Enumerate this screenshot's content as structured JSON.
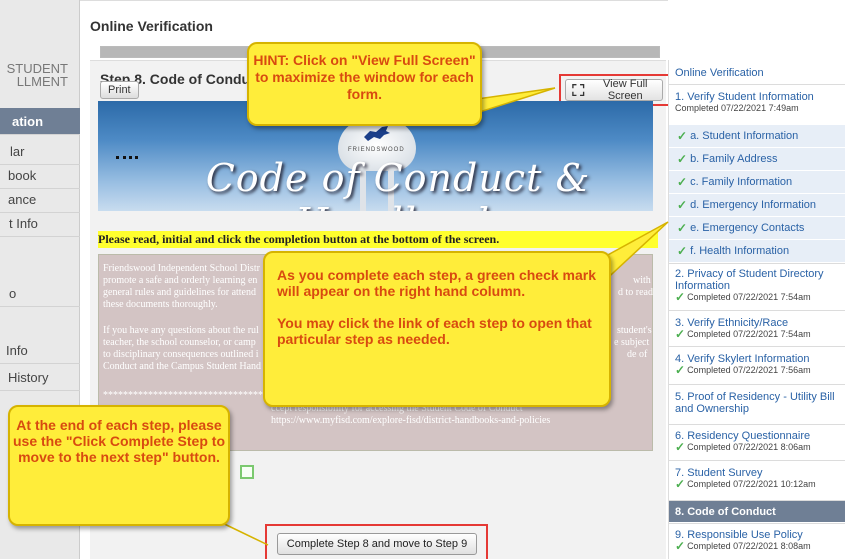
{
  "sidebar": {
    "brand_line1": "STUDENT",
    "brand_line2": "LLMENT",
    "items": [
      {
        "label": "ation",
        "active": true
      },
      {
        "label": "lar",
        "active": false
      },
      {
        "label": "book",
        "active": false
      },
      {
        "label": "ance",
        "active": false
      },
      {
        "label": "t Info",
        "active": false
      },
      {
        "label": "o",
        "active": false
      },
      {
        "label": " Info",
        "active": false
      },
      {
        "label": "History",
        "active": false
      }
    ]
  },
  "main": {
    "page_title": "Online Verification",
    "progress_percent": 100,
    "step_title": "Step 8. Code of Conduc",
    "print_label": "Print",
    "fullscreen_label": "View Full Screen",
    "banner_title": "Code of Conduct & Handbook",
    "banner_tank_label": "FRIENDSWOOD",
    "instruction": "Please read, initial and click the completion button at the bottom of the screen.",
    "notice_p1": "Friendswood Independent School Distr",
    "notice_p1b": "promote a safe and orderly learning en",
    "notice_p1c": "general rules and guidelines for attend",
    "notice_p1d": "these documents thoroughly.",
    "notice_p1e_right": "with",
    "notice_p1f_right": "d to read",
    "notice_p2": "If you have any questions about the rul",
    "notice_p2b": "teacher, the school counselor, or camp",
    "notice_p2c": "to disciplinary consequences outlined i",
    "notice_p2d": "Conduct and the Campus Student Hand",
    "notice_p2e_right": "student's",
    "notice_p2f_right": "e subject",
    "notice_p2g_right": "de of",
    "notice_dashes": "****************************************************************************************************",
    "notice_p3": "ccept responsibility for accessing the Student Code of Conduct",
    "notice_p3b": "https://www.myfisd.com/explore-fisd/district-handbooks-and-policies",
    "complete_button": "Complete Step 8 and move to Step 9"
  },
  "steps": {
    "header": "Online Verification",
    "list": [
      {
        "label": "1. Verify Student Information",
        "status": "Completed 07/22/2021 7:49am"
      },
      {
        "sub": "a. Student Information"
      },
      {
        "sub": "b. Family Address"
      },
      {
        "sub": "c. Family Information"
      },
      {
        "sub": "d. Emergency Information"
      },
      {
        "sub": "e. Emergency Contacts"
      },
      {
        "sub": "f. Health Information"
      },
      {
        "label": "2. Privacy of Student Directory Information",
        "status": "Completed 07/22/2021 7:54am"
      },
      {
        "label": "3. Verify Ethnicity/Race",
        "status": "Completed 07/22/2021 7:54am"
      },
      {
        "label": "4. Verify Skylert Information",
        "status": "Completed 07/22/2021 7:56am"
      },
      {
        "label": "5. Proof of Residency - Utility Bill and Ownership",
        "status": ""
      },
      {
        "label": "6. Residency Questionnaire",
        "status": "Completed 07/22/2021 8:06am"
      },
      {
        "label": "7. Student Survey",
        "status": "Completed 07/22/2021 10:12am"
      },
      {
        "label": "8. Code of Conduct",
        "status": "",
        "current": true
      },
      {
        "label": "9. Responsible Use Policy",
        "status": "Completed 07/22/2021 8:08am"
      }
    ]
  },
  "callouts": {
    "hint": "HINT: Click on \"View Full Screen\" to maximize the window for each form.",
    "steps_p1": "As you complete each step, a green check mark will appear on the right hand column.",
    "steps_p2": "You may click the link of each step to open that particular step as needed.",
    "end": "At the end of each step, please use the \"Click Complete Step to move to the next step\" button."
  },
  "colors": {
    "callout_fill": "#ffed3a",
    "callout_text": "#d84a10",
    "highlight_red": "#e53935",
    "active_nav": "#6f7f95",
    "link_blue": "#2a62a6",
    "check_green": "#4caf50"
  }
}
